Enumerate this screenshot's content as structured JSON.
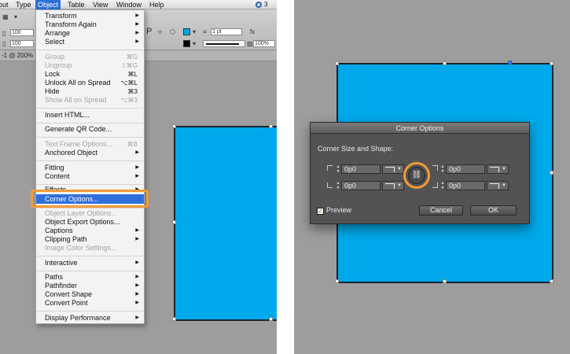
{
  "menubar": {
    "items": [
      "out",
      "Type",
      "Object",
      "Table",
      "View",
      "Window",
      "Help"
    ],
    "status_count": "3"
  },
  "controlbar": {
    "field_values": [
      "100",
      "100",
      "1 pt",
      "100%"
    ],
    "stroke_weight": "1 pt",
    "opacity": "100%"
  },
  "document_tab": {
    "label": "-1 @ 200%"
  },
  "object_menu": {
    "items": [
      {
        "label": "Transform",
        "submenu": true,
        "enabled": true
      },
      {
        "label": "Transform Again",
        "submenu": true,
        "enabled": true
      },
      {
        "label": "Arrange",
        "submenu": true,
        "enabled": true
      },
      {
        "label": "Select",
        "submenu": true,
        "enabled": true
      },
      {
        "label": "Group",
        "shortcut": "⌘G",
        "enabled": false
      },
      {
        "label": "Ungroup",
        "shortcut": "⇧⌘G",
        "enabled": false
      },
      {
        "label": "Lock",
        "shortcut": "⌘L",
        "enabled": true
      },
      {
        "label": "Unlock All on Spread",
        "shortcut": "⌥⌘L",
        "enabled": true
      },
      {
        "label": "Hide",
        "shortcut": "⌘3",
        "enabled": true
      },
      {
        "label": "Show All on Spread",
        "shortcut": "⌥⌘3",
        "enabled": false
      },
      {
        "label": "Insert HTML...",
        "enabled": true
      },
      {
        "label": "Generate QR Code...",
        "enabled": true
      },
      {
        "label": "Text Frame Options...",
        "shortcut": "⌘B",
        "enabled": false
      },
      {
        "label": "Anchored Object",
        "submenu": true,
        "enabled": true
      },
      {
        "label": "Fitting",
        "submenu": true,
        "enabled": true
      },
      {
        "label": "Content",
        "submenu": true,
        "enabled": true
      },
      {
        "label": "Effects",
        "submenu": true,
        "enabled": true
      },
      {
        "label": "Corner Options...",
        "enabled": true,
        "highlighted": true
      },
      {
        "label": "Object Layer Options...",
        "enabled": false
      },
      {
        "label": "Object Export Options...",
        "enabled": true
      },
      {
        "label": "Captions",
        "submenu": true,
        "enabled": true
      },
      {
        "label": "Clipping Path",
        "submenu": true,
        "enabled": true
      },
      {
        "label": "Image Color Settings...",
        "enabled": false
      },
      {
        "label": "Interactive",
        "submenu": true,
        "enabled": true
      },
      {
        "label": "Paths",
        "submenu": true,
        "enabled": true
      },
      {
        "label": "Pathfinder",
        "submenu": true,
        "enabled": true
      },
      {
        "label": "Convert Shape",
        "submenu": true,
        "enabled": true
      },
      {
        "label": "Convert Point",
        "submenu": true,
        "enabled": true
      },
      {
        "label": "Display Performance",
        "submenu": true,
        "enabled": true
      }
    ]
  },
  "corner_dialog": {
    "title": "Corner Options",
    "heading": "Corner Size and Shape:",
    "corners": [
      {
        "value": "0p0"
      },
      {
        "value": "0p0"
      },
      {
        "value": "0p0"
      },
      {
        "value": "0p0"
      }
    ],
    "link_icon": "chain-link-icon",
    "preview_label": "Preview",
    "preview_checked": true,
    "cancel_label": "Cancel",
    "ok_label": "OK"
  },
  "colors": {
    "shape_fill": "#00a9ea",
    "canvas_bg": "#9d9d9d",
    "menu_highlight": "#2e6fdc",
    "callout": "#f29b36",
    "dialog_bg": "#535353"
  }
}
